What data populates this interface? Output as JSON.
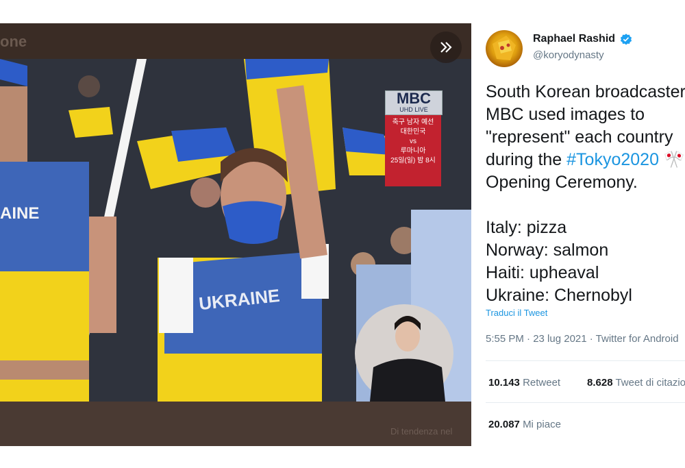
{
  "media": {
    "topbar_text": "one",
    "bottom_text": "Di tendenza nel",
    "broadcast": {
      "logo": "MBC",
      "sub": "UHD LIVE",
      "promo_lines": [
        "축구 남자 예선",
        "대한민국",
        "vs",
        "루마니아",
        "25일(일) 밤 8시"
      ]
    },
    "jersey_text": "UKRAINE",
    "jersey_text_left": "AINE"
  },
  "tweet": {
    "author_name": "Raphael Rashid",
    "handle": "@koryodynasty",
    "text_before": "South Korean broadcaster\nMBC used images to\n\"represent\" each country\nduring the ",
    "hashtag": "#Tokyo2020",
    "text_after": " 🎌\nOpening Ceremony.\n\nItaly: pizza\nNorway: salmon\nHaiti: upheaval\nUkraine: Chernobyl",
    "translate_link": "Traduci il Tweet",
    "timestamp": "5:55 PM · 23 lug 2021 · Twitter for Android",
    "retweets_count": "10.143",
    "retweets_label": "Retweet",
    "quotes_count": "8.628",
    "quotes_label": "Tweet di citazione",
    "likes_count": "20.087",
    "likes_label": "Mi piace"
  },
  "colors": {
    "ukraine_blue": "#2d5cc8",
    "ukraine_yellow": "#f2d21b",
    "link_blue": "#1b95e0"
  }
}
